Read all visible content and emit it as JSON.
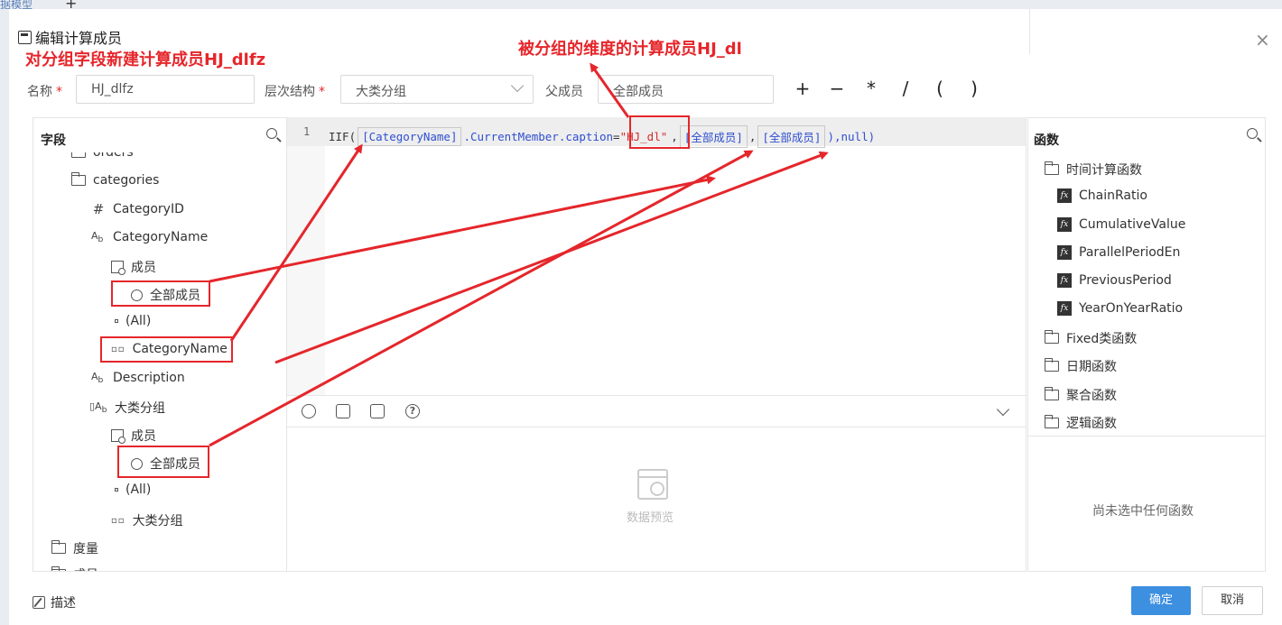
{
  "background": {
    "tab_label": "据模型",
    "plus_label": "+"
  },
  "dialog": {
    "title": "编辑计算成员",
    "close_label": "×"
  },
  "annotations": {
    "left": "对分组字段新建计算成员HJ_dlfz",
    "center": "被分组的维度的计算成员HJ_dl"
  },
  "form": {
    "name_label": "名称",
    "name_value": "HJ_dlfz",
    "hierarchy_label": "层次结构",
    "hierarchy_value": "大类分组",
    "parent_label": "父成员",
    "parent_value": "全部成员",
    "required_mark": "*"
  },
  "operators": [
    "+",
    "−",
    "*",
    "/",
    "(",
    ")"
  ],
  "fields_panel": {
    "title": "字段",
    "items": [
      {
        "label": "orders",
        "icon": "folder-icon"
      },
      {
        "label": "categories",
        "icon": "folder-open-icon"
      },
      {
        "label": "CategoryID",
        "icon": "hash-icon"
      },
      {
        "label": "CategoryName",
        "icon": "text-field-icon"
      },
      {
        "label": "成员",
        "icon": "member-icon"
      },
      {
        "label": "全部成员",
        "icon": "circle-icon"
      },
      {
        "label": "(All)",
        "icon": "level-icon"
      },
      {
        "label": "CategoryName",
        "icon": "level-dots-icon"
      },
      {
        "label": "Description",
        "icon": "text-field-icon"
      },
      {
        "label": "大类分组",
        "icon": "group-field-icon"
      },
      {
        "label": "成员",
        "icon": "member-icon"
      },
      {
        "label": "全部成员",
        "icon": "circle-icon"
      },
      {
        "label": "(All)",
        "icon": "level-icon"
      },
      {
        "label": "大类分组",
        "icon": "level-dots-icon"
      },
      {
        "label": "度量",
        "icon": "folder-icon"
      },
      {
        "label": "成员",
        "icon": "folder-icon"
      }
    ]
  },
  "editor": {
    "line_number": "1",
    "tokens": {
      "t1": "IIF(",
      "t2": "[CategoryName]",
      "t3": ".CurrentMember.caption",
      "t4": "=",
      "t5": "\"HJ_dl\"",
      "t6": ",",
      "t7": "[全部成员]",
      "t8": ",",
      "t9": "[全部成员]",
      "t10": "),null)"
    },
    "preview_text": "数据预览"
  },
  "functions_panel": {
    "title": "函数",
    "items": [
      {
        "label": "时间计算函数",
        "type": "folder-open"
      },
      {
        "label": "ChainRatio",
        "type": "fx"
      },
      {
        "label": "CumulativeValue",
        "type": "fx"
      },
      {
        "label": "ParallelPeriodEn",
        "type": "fx"
      },
      {
        "label": "PreviousPeriod",
        "type": "fx"
      },
      {
        "label": "YearOnYearRatio",
        "type": "fx"
      },
      {
        "label": "Fixed类函数",
        "type": "folder"
      },
      {
        "label": "日期函数",
        "type": "folder"
      },
      {
        "label": "聚合函数",
        "type": "folder"
      },
      {
        "label": "逻辑函数",
        "type": "folder"
      }
    ],
    "empty_text": "尚未选中任何函数",
    "fx_glyph": "fx"
  },
  "footer": {
    "describe_label": "描述",
    "ok_label": "确定",
    "cancel_label": "取消"
  },
  "colors": {
    "annotation_red": "#e5262b",
    "primary_blue": "#3d8fe0",
    "token_blue": "#2f4fd0"
  }
}
